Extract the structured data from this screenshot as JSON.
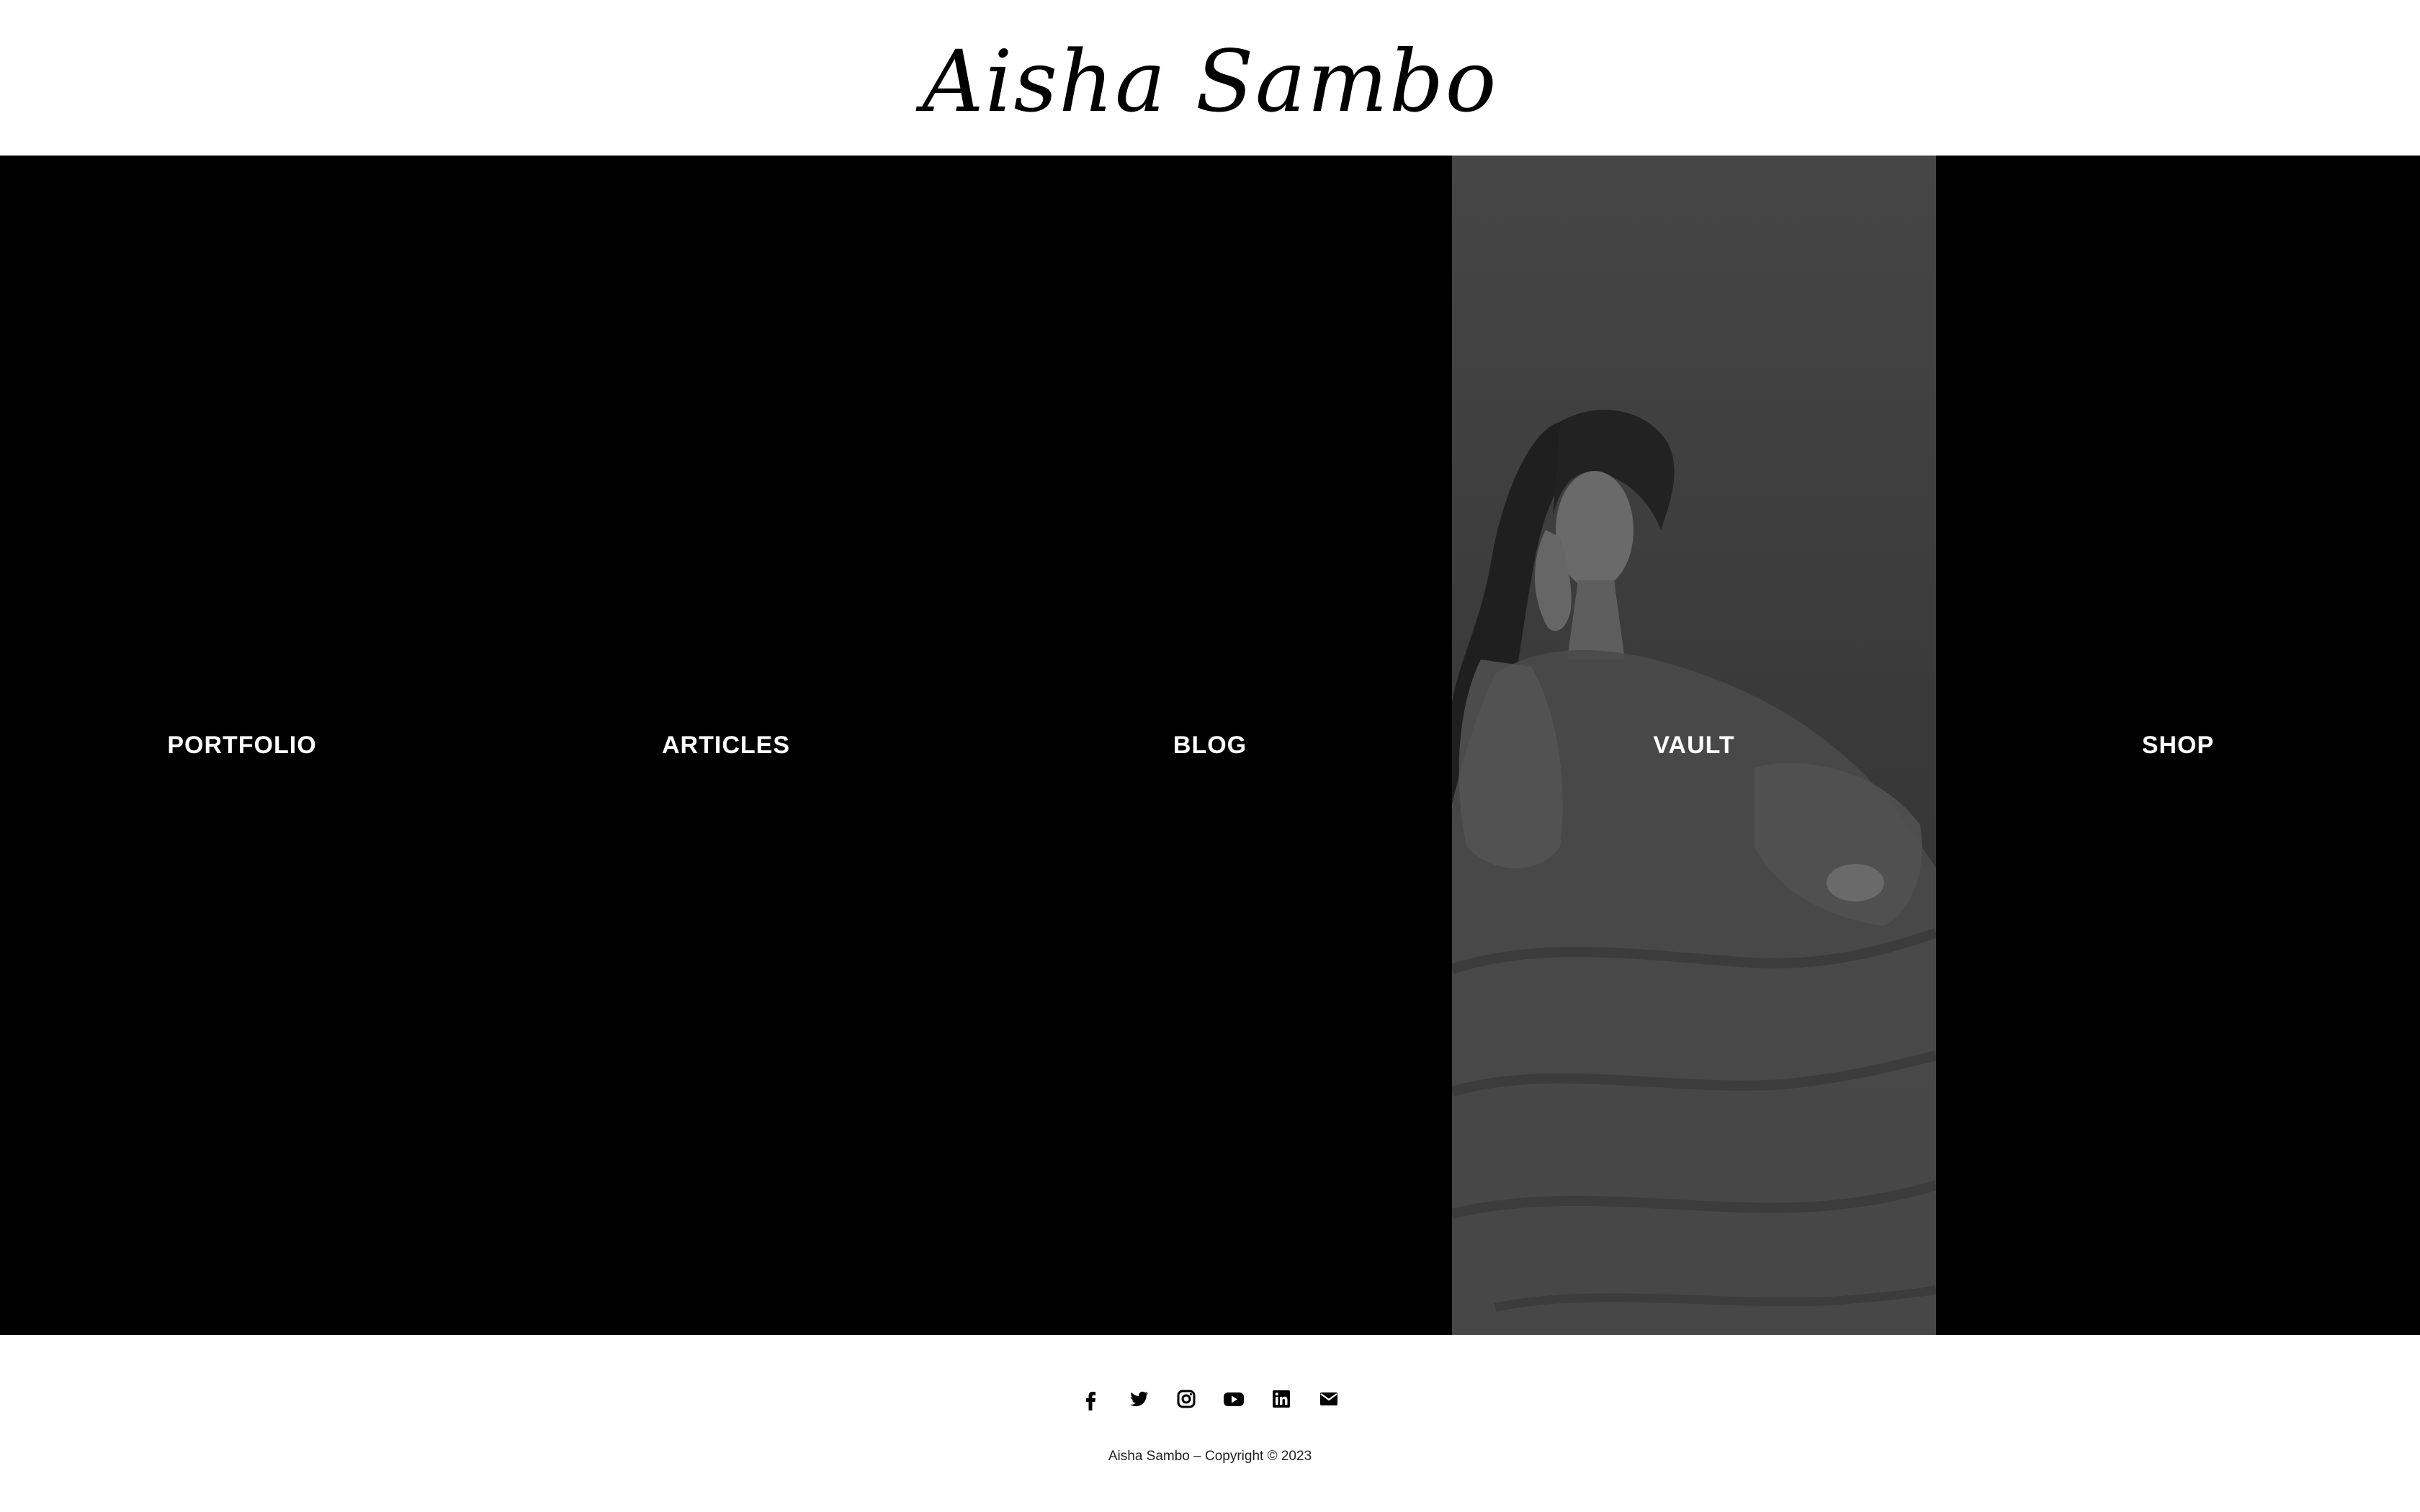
{
  "header": {
    "logo_text": "Aisha Sambo"
  },
  "menu": {
    "items": [
      {
        "label": "PORTFOLIO"
      },
      {
        "label": "ARTICLES"
      },
      {
        "label": "BLOG"
      },
      {
        "label": "VAULT",
        "active": true
      },
      {
        "label": "SHOP"
      }
    ]
  },
  "footer": {
    "social_icons": [
      "facebook-icon",
      "twitter-icon",
      "instagram-icon",
      "youtube-icon",
      "linkedin-icon",
      "envelope-icon"
    ],
    "copyright": "Aisha Sambo – Copyright © 2023"
  },
  "colors": {
    "background": "#ffffff",
    "panel": "#000000",
    "text_on_panel": "#ffffff"
  }
}
